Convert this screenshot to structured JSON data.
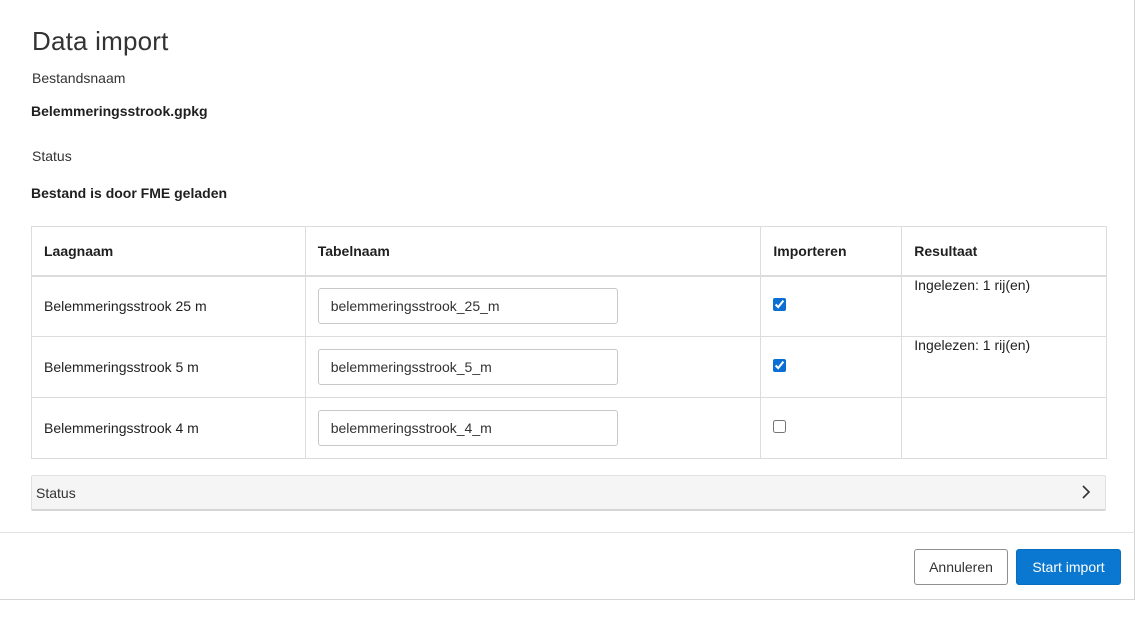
{
  "dialog": {
    "title": "Data import",
    "filename_label": "Bestandsnaam",
    "filename_value": "Belemmeringsstrook.gpkg",
    "status_label": "Status",
    "status_value": "Bestand is door FME geladen"
  },
  "table": {
    "headers": [
      "Laagnaam",
      "Tabelnaam",
      "Importeren",
      "Resultaat"
    ],
    "rows": [
      {
        "layer": "Belemmeringsstrook 25 m",
        "table_name": "belemmeringsstrook_25_m",
        "import": true,
        "result": "Ingelezen: 1 rij(en)"
      },
      {
        "layer": "Belemmeringsstrook 5 m",
        "table_name": "belemmeringsstrook_5_m",
        "import": true,
        "result": "Ingelezen: 1 rij(en)"
      },
      {
        "layer": "Belemmeringsstrook 4 m",
        "table_name": "belemmeringsstrook_4_m",
        "import": false,
        "result": ""
      }
    ]
  },
  "accordion": {
    "label": "Status",
    "icon": "chevron-right-icon"
  },
  "footer": {
    "cancel_label": "Annuleren",
    "start_label": "Start import"
  },
  "colors": {
    "primary": "#0a78d0",
    "checkbox_accent": "#0a6fd4"
  }
}
